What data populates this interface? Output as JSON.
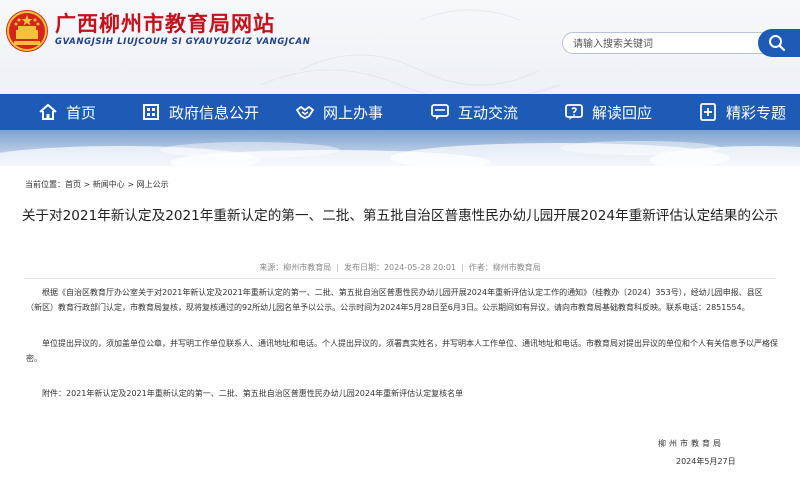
{
  "site": {
    "title": "广西柳州市教育局网站",
    "subtitle": "GVANGJSIH LIUJCOUH SI GYAUYUZGIZ VANGJCAN"
  },
  "search": {
    "placeholder": "请输入搜索关键词"
  },
  "nav": {
    "items": [
      {
        "label": "首页",
        "icon": "home-icon"
      },
      {
        "label": "政府信息公开",
        "icon": "building-icon"
      },
      {
        "label": "网上办事",
        "icon": "handshake-icon"
      },
      {
        "label": "互动交流",
        "icon": "chat-icon"
      },
      {
        "label": "解读回应",
        "icon": "qa-icon"
      },
      {
        "label": "精彩专题",
        "icon": "topic-icon"
      }
    ]
  },
  "breadcrumb": {
    "prefix": "当前位置：",
    "items": [
      "首页",
      "新闻中心",
      "网上公示"
    ],
    "separator": " > "
  },
  "article": {
    "title": "关于对2021年新认定及2021年重新认定的第一、二批、第五批自治区普惠性民办幼儿园开展2024年重新评估认定结果的公示",
    "meta": {
      "source_label": "来源：",
      "source": "柳州市教育局",
      "date_label": "发布日期：",
      "date": "2024-05-28 20:01",
      "author_label": "作者：",
      "author": "柳州市教育局"
    },
    "paragraph1": "根据《自治区教育厅办公室关于对2021年新认定及2021年重新认定的第一、二批、第五批自治区普惠性民办幼儿园开展2024年重新评估认定工作的通知》（桂教办〔2024〕353号），经幼儿园申报、县区（新区）教育行政部门认定，市教育局复核，现将复核通过的92所幼儿园名单予以公示。公示时间为2024年5月28日至6月3日。公示期间如有异议，请向市教育局基础教育科反映。联系电话：2851554。",
    "paragraph2": "单位提出异议的，须加盖单位公章，并写明工作单位联系人、通讯地址和电话。个人提出异议的，须署真实姓名，并写明本人工作单位、通讯地址和电话。市教育局对提出异议的单位和个人有关信息予以严格保密。",
    "attachment": "附件：2021年新认定及2021年重新认定的第一、二批、第五批自治区普惠性民办幼儿园2024年重新评估认定复核名单",
    "sign_org": "柳州市教育局",
    "sign_date": "2024年5月27日"
  },
  "colors": {
    "nav_bg": "#1d5bb6",
    "title_red": "#c4111b",
    "subtitle_blue": "#1d3f8c"
  }
}
